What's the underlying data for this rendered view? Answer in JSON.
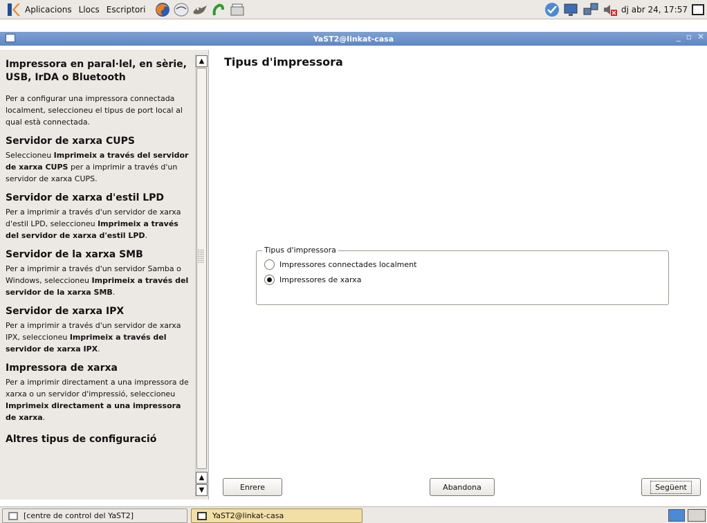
{
  "top_panel": {
    "menus": [
      "Aplicacions",
      "Llocs",
      "Escriptori"
    ],
    "clock": "dj abr 24, 17:57"
  },
  "window": {
    "title": "YaST2@linkat-casa"
  },
  "help": {
    "sections": [
      {
        "heading": "Impressora en paral·lel, en sèrie, USB, IrDA o Bluetooth",
        "text": "Per a configurar una impressora connectada localment, seleccioneu el tipus de port local al qual està connectada."
      },
      {
        "heading": "Servidor de xarxa CUPS",
        "text_before": "Seleccioneu ",
        "bold": "Imprimeix a través del servidor de xarxa CUPS",
        "text_after": " per a imprimir a través d'un servidor de xarxa CUPS."
      },
      {
        "heading": "Servidor de xarxa d'estil LPD",
        "text_before": "Per a imprimir a través d'un servidor de xarxa d'estil LPD, seleccioneu ",
        "bold": "Imprimeix a través del servidor de xarxa d'estil LPD",
        "text_after": "."
      },
      {
        "heading": "Servidor de la xarxa SMB",
        "text_before": "Per a imprimir a través d'un servidor Samba o Windows, seleccioneu ",
        "bold": "Imprimeix a través del servidor de la xarxa SMB",
        "text_after": "."
      },
      {
        "heading": "Servidor de xarxa IPX",
        "text_before": "Per a imprimir a través d'un servidor de xarxa IPX, seleccioneu ",
        "bold": "Imprimeix a través del servidor de xarxa IPX",
        "text_after": "."
      },
      {
        "heading": "Impressora de xarxa",
        "text_before": "Per a imprimir directament a una impressora de xarxa o un servidor d'impressió, seleccioneu ",
        "bold": "Imprimeix directament a una impressora de xarxa",
        "text_after": "."
      },
      {
        "heading": "Altres tipus de configuració"
      }
    ]
  },
  "main": {
    "heading": "Tipus d'impressora",
    "group_label": "Tipus d'impressora",
    "options": [
      {
        "label": "Impressores connectades localment",
        "selected": false
      },
      {
        "label": "Impressores de xarxa",
        "selected": true
      }
    ],
    "buttons": {
      "back": "Enrere",
      "abort": "Abandona",
      "next": "Següent"
    }
  },
  "taskbar": {
    "tasks": [
      "[centre de control del YaST2]",
      "YaST2@linkat-casa"
    ]
  },
  "colors": {
    "titlebar": "#6b8fc8",
    "active_task": "#f2dfa6"
  }
}
